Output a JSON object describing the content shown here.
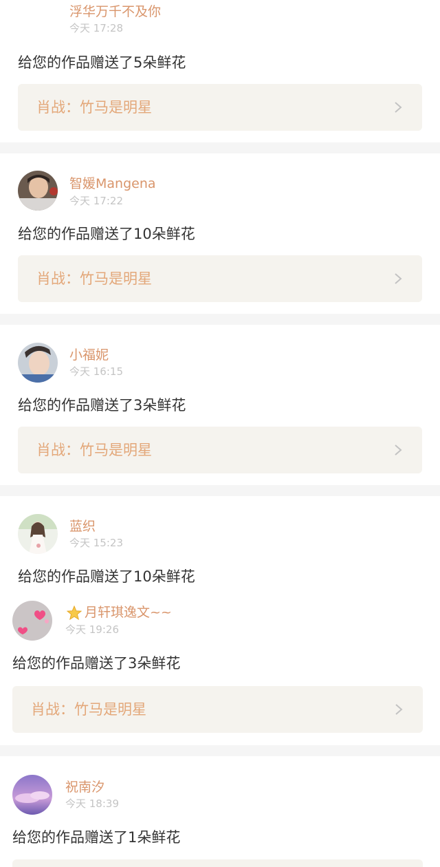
{
  "colors": {
    "accent_name": "#d9956b",
    "work_title": "#e3a779",
    "time_gray": "#c4c4c4",
    "card_bg": "#f5f3ee",
    "divider_bg": "#f5f5f5"
  },
  "items": [
    {
      "name": "浮华万千不及你",
      "time": "今天 17:28",
      "message": "给您的作品赠送了5朵鲜花",
      "work": "肖战：竹马是明星"
    },
    {
      "name": "智媛Mangena",
      "time": "今天 17:22",
      "message": "给您的作品赠送了10朵鲜花",
      "work": "肖战：竹马是明星"
    },
    {
      "name": "小福妮",
      "time": "今天 16:15",
      "message": "给您的作品赠送了3朵鲜花",
      "work": "肖战：竹马是明星"
    },
    {
      "name": "蓝织",
      "time": "今天 15:23",
      "message": "给您的作品赠送了10朵鲜花"
    },
    {
      "name": "月轩琪逸文~~",
      "time": "今天 19:26",
      "message": "给您的作品赠送了3朵鲜花",
      "work": "肖战：竹马是明星"
    },
    {
      "name": "祝南汐",
      "time": "今天 18:39",
      "message": "给您的作品赠送了1朵鲜花"
    }
  ]
}
